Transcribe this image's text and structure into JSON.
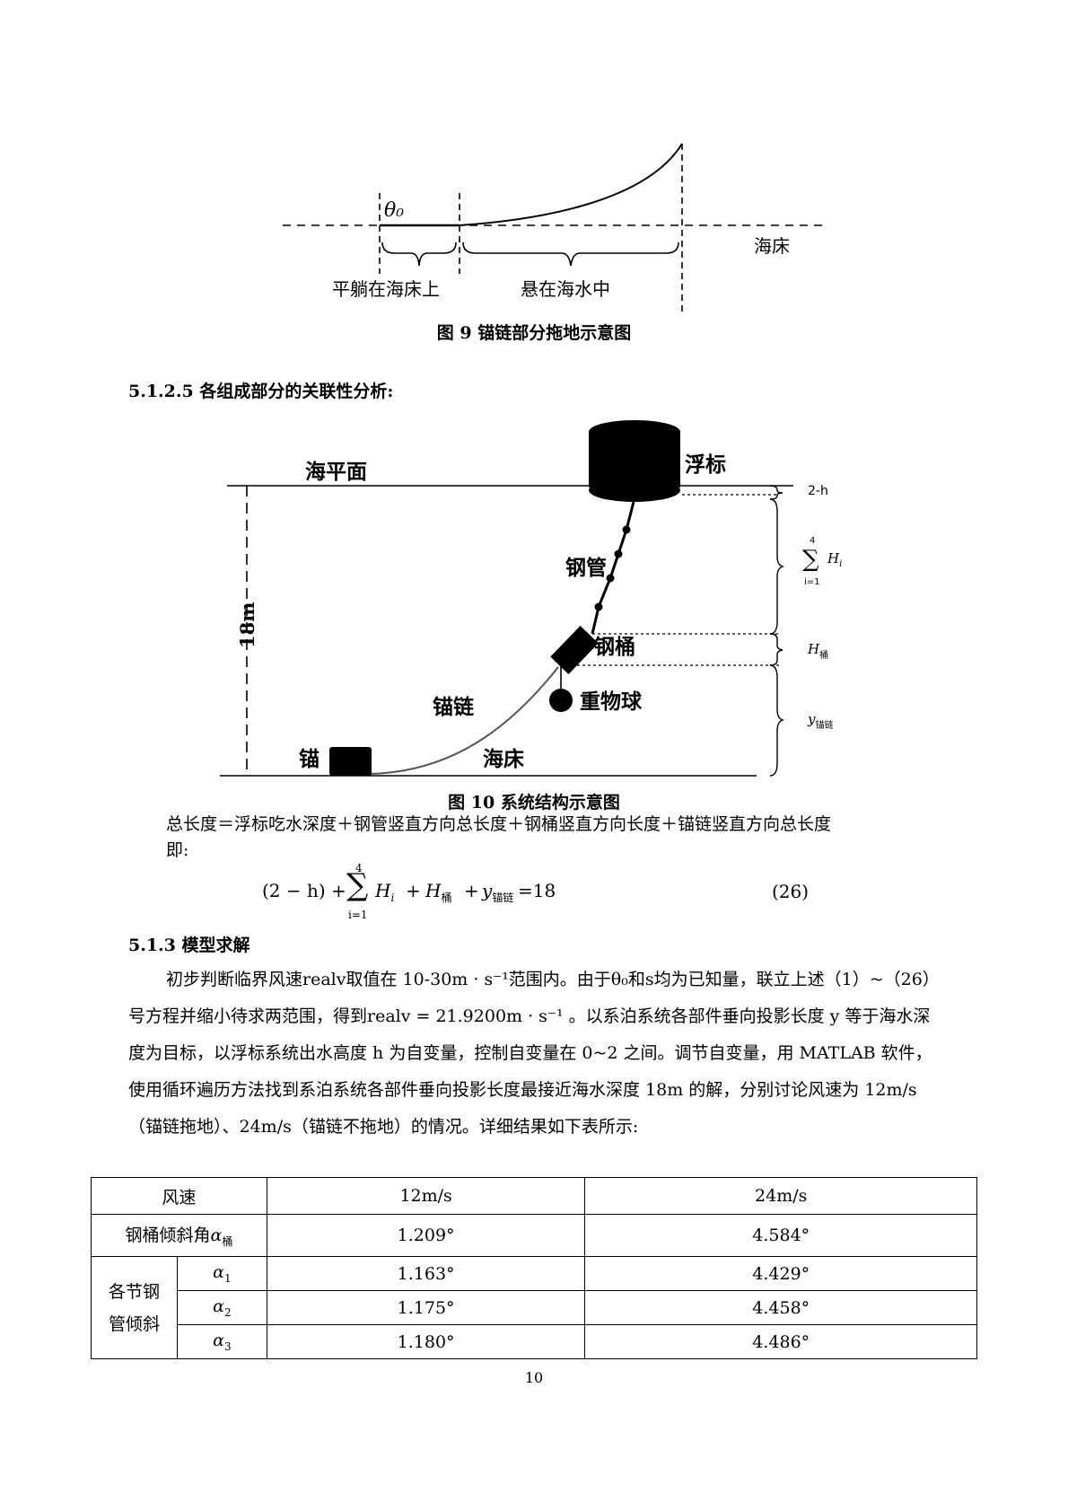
{
  "fig9": {
    "theta_label": "θ₀",
    "left_label": "平躺在海床上",
    "right_label": "悬在海水中",
    "seabed_label": "海床",
    "caption": "图 9 锚链部分拖地示意图"
  },
  "section_5125": {
    "heading": "5.1.2.5 各组成部分的关联性分析:"
  },
  "fig10": {
    "sea_surface": "海平面",
    "buoy": "浮标",
    "depth_label": "18m",
    "steel_pipe": "钢管",
    "steel_drum": "钢桶",
    "heavy_ball": "重物球",
    "chain": "锚链",
    "anchor": "锚",
    "seabed": "海床",
    "brace_1": "2-h",
    "brace_2_sum_top": "4",
    "brace_2_sum_bottom": "i=1",
    "brace_2_var": "H",
    "brace_2_sub": "i",
    "brace_3_var": "H",
    "brace_3_sub": "桶",
    "brace_4_var": "y",
    "brace_4_sub": "锚链",
    "caption": "图 10 系统结构示意图"
  },
  "total_length_text": "总长度＝浮标吃水深度＋钢管竖直方向总长度＋钢桶竖直方向长度＋锚链竖直方向总长度",
  "ji_text": "即:",
  "equation": {
    "lhs": "(2 − h) +",
    "sum_top": "4",
    "sum_bottom": "i=1",
    "term_h": "H",
    "term_h_sub": "i",
    "plus1": "+",
    "term_hb": "H",
    "term_hb_sub": "桶",
    "plus2": "+",
    "term_y": "y",
    "term_y_sub": "锚链",
    "rhs": "=18",
    "number": "(26)"
  },
  "section_513": {
    "heading": "5.1.3 模型求解"
  },
  "solution_paragraph": {
    "p1": "初步判断临界风速realv取值在 10-30m · s⁻¹范围内。由于θ₀和s均为已知量，联立上述（1）~（26）号方程并缩小待求两范围，得到realv = 21.9200m · s⁻¹ 。以系泊系统各部件垂向投影长度 y 等于海水深度为目标，以浮标系统出水高度 h 为自变量，控制自变量在 0~2 之间。调节自变量，用 MATLAB 软件，使用循环遍历方法找到系泊系统各部件垂向投影长度最接近海水深度 18m 的解，分别讨论风速为 12m/s（锚链拖地）、24m/s（锚链不拖地）的情况。详细结果如下表所示:"
  },
  "results_table": {
    "header": {
      "label": "风速",
      "c1": "12m/s",
      "c2": "24m/s"
    },
    "drum_row": {
      "label": "钢桶倾斜角",
      "sym": "α",
      "sub": "桶",
      "c1": "1.209°",
      "c2": "4.584°"
    },
    "pipe_group_label_line1": "各节钢",
    "pipe_group_label_line2": "管倾斜",
    "pipe_rows": [
      {
        "sym": "α",
        "sub": "1",
        "c1": "1.163°",
        "c2": "4.429°"
      },
      {
        "sym": "α",
        "sub": "2",
        "c1": "1.175°",
        "c2": "4.458°"
      },
      {
        "sym": "α",
        "sub": "3",
        "c1": "1.180°",
        "c2": "4.486°"
      }
    ]
  },
  "page_number": "10"
}
